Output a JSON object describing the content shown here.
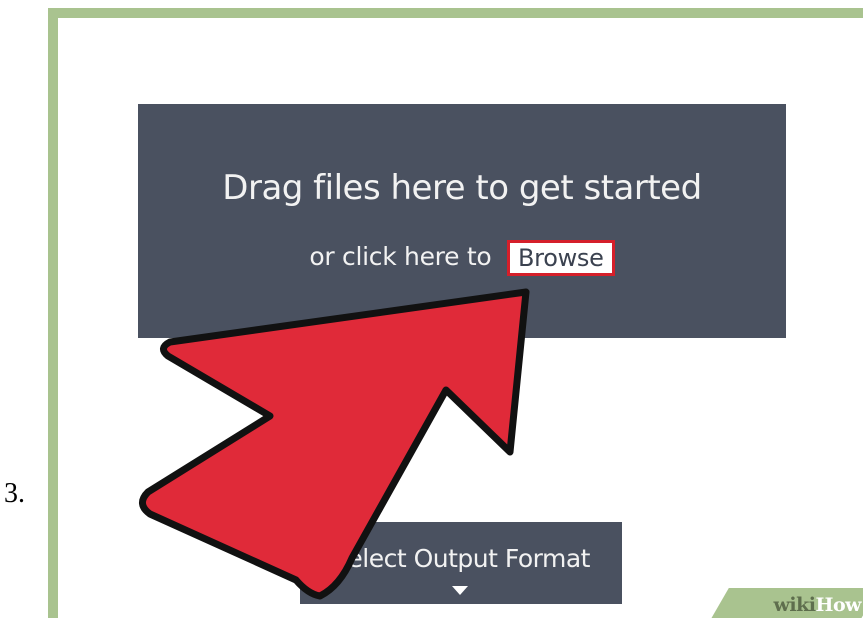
{
  "step": {
    "number": "3."
  },
  "upload": {
    "heading": "Drag files here to get started",
    "subtext": "or click here to",
    "browse_label": "Browse"
  },
  "format": {
    "label": "Select Output Format",
    "icon": "caret-down-icon"
  },
  "annotation": {
    "icon": "pointer-arrow-icon",
    "color": "#e02a39"
  },
  "watermark": {
    "part1": "wiki",
    "part2": "How"
  },
  "colors": {
    "frame": "#a9c38f",
    "panel": "#4a5160",
    "highlight": "#d51f2a"
  }
}
